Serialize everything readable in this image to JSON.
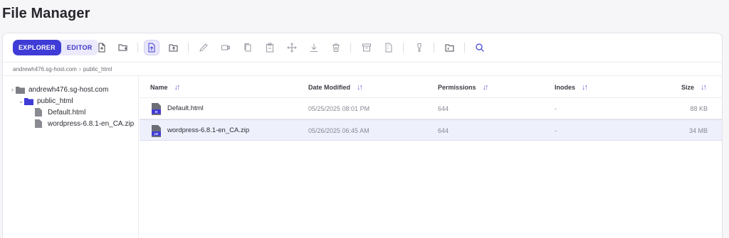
{
  "page_title": "File Manager",
  "toolbar": {
    "explorer_label": "EXPLORER",
    "editor_label": "EDITOR",
    "icons": [
      "new-file-icon",
      "new-folder-icon",
      "upload-file-icon",
      "upload-folder-icon",
      "rename-icon",
      "copy-path-icon",
      "copy-icon",
      "paste-icon",
      "move-icon",
      "download-icon",
      "delete-icon",
      "archive-icon",
      "extract-icon",
      "permissions-icon",
      "folder-info-icon",
      "search-icon"
    ]
  },
  "breadcrumb": {
    "host": "andrewh476.sg-host.com",
    "folder": "public_html"
  },
  "tree": {
    "root": "andrewh476.sg-host.com",
    "folder": "public_html",
    "files": [
      "Default.html",
      "wordpress-6.8.1-en_CA.zip"
    ]
  },
  "table": {
    "columns": [
      "Name",
      "Date Modified",
      "Permissions",
      "Inodes",
      "Size"
    ],
    "rows": [
      {
        "name": "Default.html",
        "icon_badge": "H",
        "modified": "05/25/2025 08:01 PM",
        "permissions": "644",
        "inodes": "-",
        "size": "88 KB"
      },
      {
        "name": "wordpress-6.8.1-en_CA.zip",
        "icon_badge": "ZIP",
        "modified": "05/26/2025 06:45 AM",
        "permissions": "644",
        "inodes": "-",
        "size": "34 MB"
      }
    ]
  },
  "colors": {
    "accent": "#3f3bd6",
    "selected_row": "#eef0fb"
  }
}
